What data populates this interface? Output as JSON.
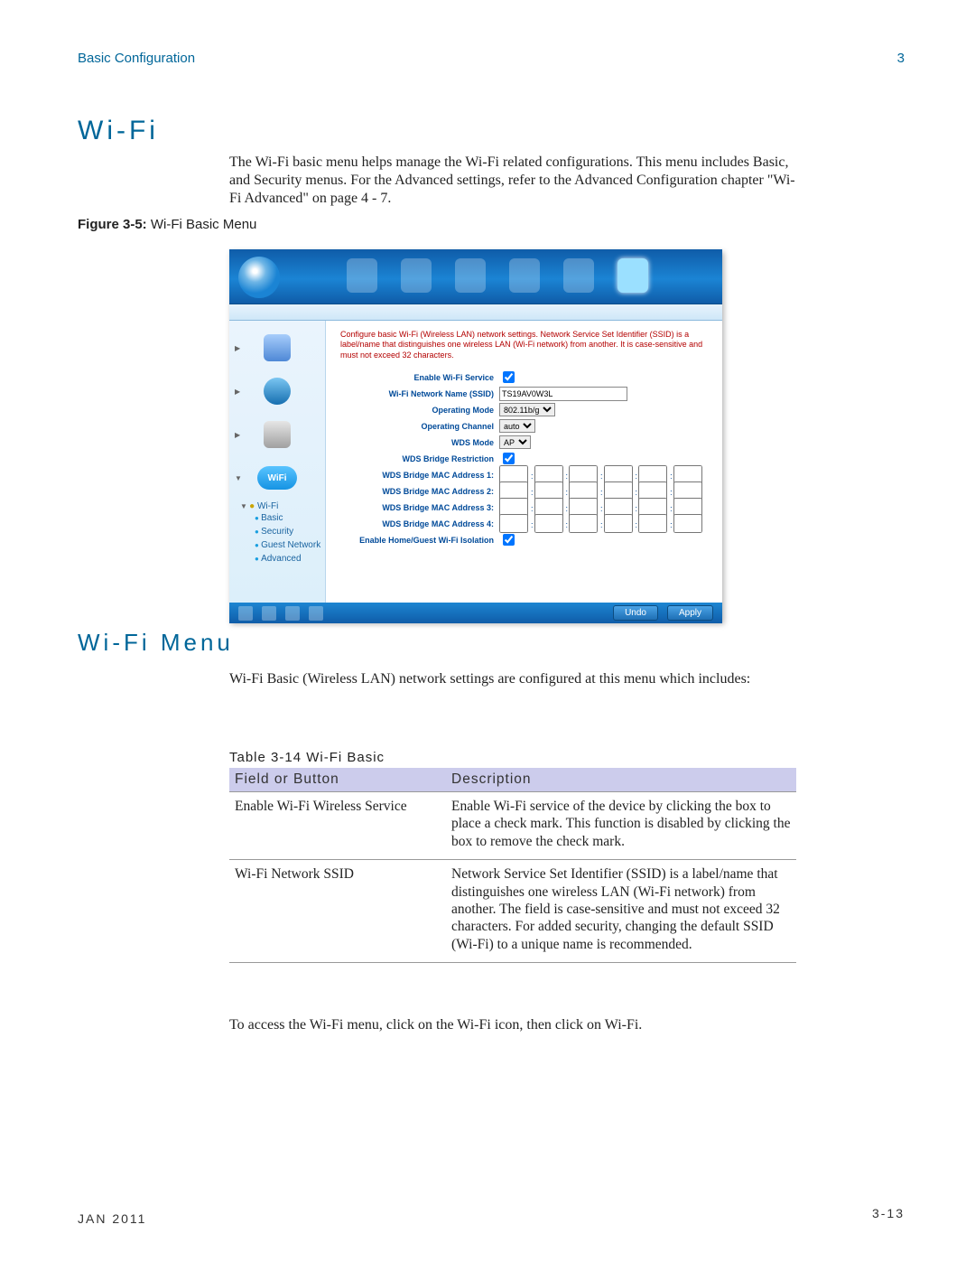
{
  "header": {
    "left": "Basic Configuration",
    "right": "3"
  },
  "section": {
    "title": "Wi-Fi",
    "intro": "The Wi-Fi basic menu helps manage the Wi-Fi related configurations. This menu includes Basic, and Security menus. For the Advanced settings, refer to the Advanced Configuration chapter \"Wi-Fi Advanced\" on page 4 - 7.",
    "figure_label_bold": "Figure 3-5:",
    "figure_label_rest": " Wi-Fi Basic Menu"
  },
  "screenshot": {
    "desc": "Configure basic Wi-Fi (Wireless LAN) network settings. Network Service Set Identifier (SSID) is a label/name that distinguishes one wireless LAN (Wi-Fi network) from another. It is case-sensitive and must not exceed 32 characters.",
    "labels": {
      "enable": "Enable Wi-Fi Service",
      "ssid": "Wi-Fi Network Name (SSID)",
      "opmode": "Operating Mode",
      "channel": "Operating Channel",
      "wdsmode": "WDS Mode",
      "wdsrestrict": "WDS Bridge Restriction",
      "mac1": "WDS Bridge MAC Address 1:",
      "mac2": "WDS Bridge MAC Address 2:",
      "mac3": "WDS Bridge MAC Address 3:",
      "mac4": "WDS Bridge MAC Address 4:",
      "isolate": "Enable Home/Guest Wi-Fi Isolation"
    },
    "values": {
      "ssid": "TS19AV0W3L",
      "opmode": "802.11b/g",
      "channel": "auto",
      "wdsmode": "AP"
    },
    "tree": {
      "root": "Wi-Fi",
      "items": [
        "Basic",
        "Security",
        "Guest Network",
        "Advanced"
      ]
    },
    "wifi_badge": "WiFi",
    "buttons": {
      "undo": "Undo",
      "apply": "Apply"
    }
  },
  "section2": {
    "title": "Wi-Fi Menu",
    "intro": "Wi-Fi Basic (Wireless LAN) network settings are configured at this menu which includes:"
  },
  "table": {
    "caption": "Table 3-14 Wi-Fi Basic",
    "head": {
      "c1": "Field or Button",
      "c2": "Description"
    },
    "rows": [
      {
        "f": "Enable Wi-Fi Wireless Service",
        "d": "Enable Wi-Fi service of the device by clicking the box to place a check mark. This function is disabled by clicking the box to remove the check mark."
      },
      {
        "f": "Wi-Fi Network SSID",
        "d": "Network Service Set Identifier (SSID) is a label/name that distinguishes one wireless LAN (Wi-Fi network) from another. The field is case-sensitive and must not exceed 32 characters. For added security, changing the default SSID (Wi-Fi) to a unique name is recommended."
      }
    ]
  },
  "access_note": "To access the Wi-Fi menu, click on the Wi-Fi icon, then click on Wi-Fi.",
  "footer": {
    "date": "JAN 2011",
    "page": "3-13"
  }
}
